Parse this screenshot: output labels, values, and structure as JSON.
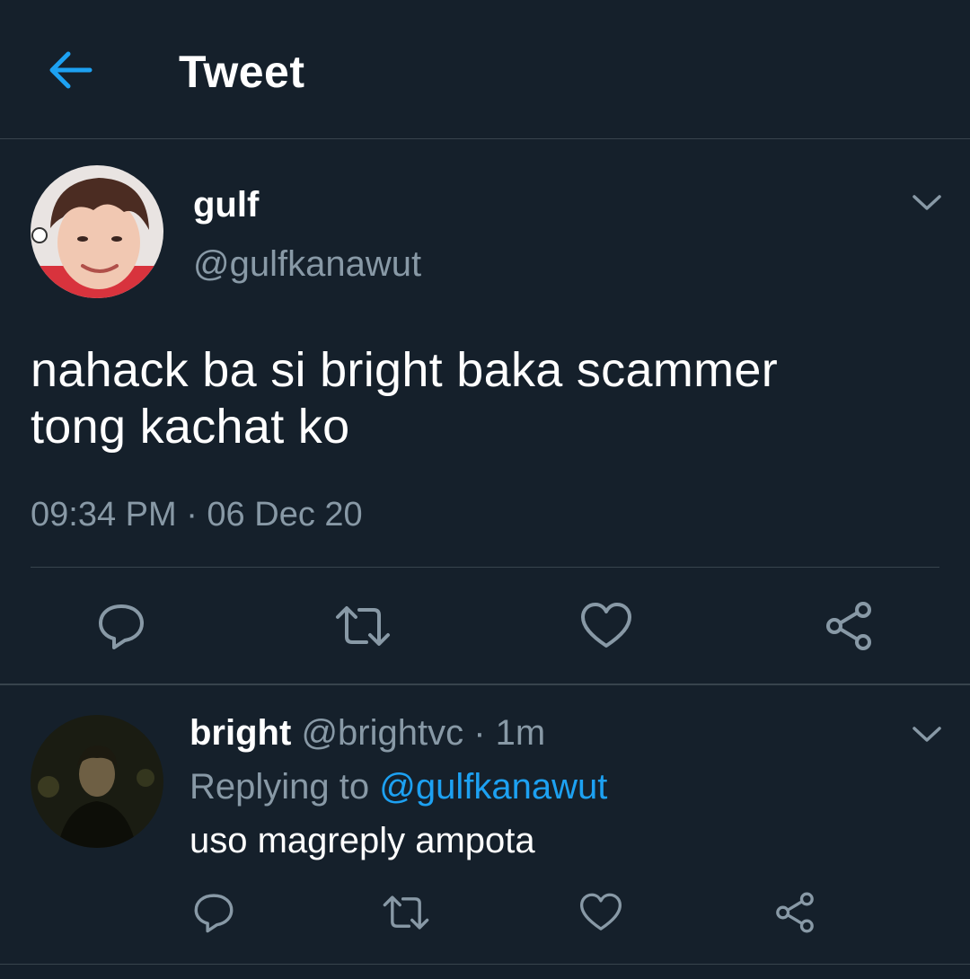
{
  "header": {
    "title": "Tweet",
    "back_icon": "arrow-left-icon",
    "accent": "#1da1f2"
  },
  "tweet": {
    "display_name": "gulf",
    "handle": "@gulfkanawut",
    "text_line1": "nahack ba si bright baka scammer",
    "text_line2": "tong kachat ko",
    "timestamp": "09:34 PM · 06 Dec 20",
    "actions": [
      "reply-icon",
      "retweet-icon",
      "like-icon",
      "share-icon"
    ]
  },
  "reply": {
    "display_name": "bright",
    "handle": "@brightvc",
    "separator": " · ",
    "time": "1m",
    "replying_to_label": "Replying to ",
    "replying_to_handle": "@gulfkanawut",
    "text": "uso magreply ampota",
    "actions": [
      "reply-icon",
      "retweet-icon",
      "like-icon",
      "share-icon"
    ]
  },
  "colors": {
    "background": "#15202b",
    "secondary_text": "#8899a6",
    "divider": "#38444d",
    "link": "#1da1f2"
  }
}
